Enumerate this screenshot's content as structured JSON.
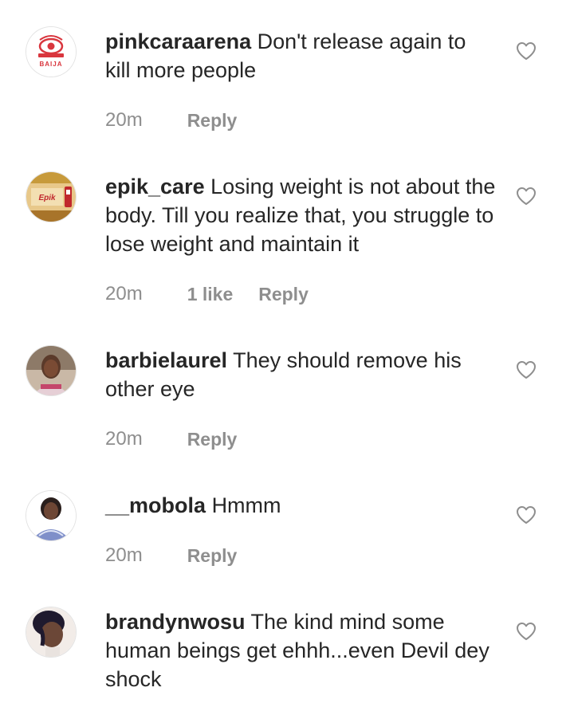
{
  "comments": [
    {
      "username": "pinkcaraarena",
      "text": "Don't release again to kill more people",
      "time": "20m",
      "likes": "",
      "reply_label": "Reply",
      "avatar_icon": "bbnaija-logo-avatar",
      "avatar_text": "BAIJA"
    },
    {
      "username": "epik_care",
      "text": "Losing weight is not about the body. Till you realize that, you struggle to lose weight and maintain it",
      "time": "20m",
      "likes": "1 like",
      "reply_label": "Reply",
      "avatar_icon": "epik-care-logo-avatar",
      "avatar_text": "Epik"
    },
    {
      "username": "barbielaurel",
      "text": "They should remove his other eye",
      "time": "20m",
      "likes": "",
      "reply_label": "Reply",
      "avatar_icon": "user-photo-avatar"
    },
    {
      "username": "__mobola",
      "text": "Hmmm",
      "time": "20m",
      "likes": "",
      "reply_label": "Reply",
      "avatar_icon": "user-photo-avatar"
    },
    {
      "username": "brandynwosu",
      "text": "The kind mind some human beings get ehhh...even Devil dey shock",
      "time": "",
      "likes": "",
      "reply_label": "",
      "avatar_icon": "user-photo-avatar"
    }
  ],
  "colors": {
    "text": "#262626",
    "secondary": "#8e8e8e",
    "heart_outline": "#8e8e8e"
  }
}
